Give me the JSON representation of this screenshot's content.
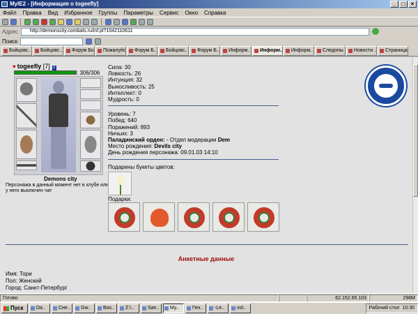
{
  "window": {
    "title": "MyIE2 - [Информация о togeefly]"
  },
  "menu": [
    "Файл",
    "Правка",
    "Вид",
    "Избранное",
    "Группы",
    "Параметры",
    "Сервис",
    "Окно",
    "Справка"
  ],
  "address": {
    "label": "Адрес",
    "value": "http://demonscity.combats.ru/inf.pl?1042110611"
  },
  "search": {
    "label": "Поиск"
  },
  "tabs": [
    "Бойцовс..",
    "Бойцовс..",
    "Форум Бойц..",
    "Пожалуйста ..",
    "Форум Б..",
    "Бойцовс..",
    "Форум Б..",
    "Информ..",
    "Информ..",
    "Информ..",
    "Следопы..",
    "Новости ..",
    "Страница па.."
  ],
  "character": {
    "name": "togeefly",
    "level": "[7]",
    "info_badge": "i",
    "hp": "306/306",
    "hp_fraction": 1.0,
    "city": "Demons city",
    "status": "Персонажа в данный момент нет в клубе или у него выключен чат"
  },
  "stats": {
    "strength": "Сила: 30",
    "agility": "Ловкость: 26",
    "intuition": "Интуиция: 32",
    "endurance": "Выносливость: 25",
    "intellect": "Интеллект: 0",
    "wisdom": "Мудрость: 0",
    "level": "Уровень: 7",
    "wins": "Побед: 640",
    "losses": "Поражений: 893",
    "draws": "Ничьих: 3",
    "order_label": "Паладинский орден:",
    "order_value": " - Отдел модерации ",
    "order_dept": "Dem",
    "birthplace_label": "Место рождения:",
    "birthplace_value": "Devils city",
    "birthday": "День рождения персонажа: 09.01.03 14:10"
  },
  "gifts": {
    "bouquets_label": "Подарены букеты цветов:",
    "gifts_label": "Подарки:"
  },
  "anketa": {
    "title": "Анкетные данные",
    "name": "Имя: Тори",
    "gender": "Пол: Женский",
    "city": "Город: Санкт-Петербург"
  },
  "statusbar": {
    "ready": "Готово",
    "ip": "62.152.65.103",
    "mem": "298M"
  },
  "taskbar": {
    "start": "Пуск",
    "tasks": [
      "Da..",
      "Сне..",
      "Gw..",
      "Вхо..",
      "Z:\\..",
      "San..",
      "My..",
      "Ген..",
      "-Le..",
      "vol.."
    ],
    "tray_label": "Рабочий стол",
    "clock": "10:30"
  }
}
